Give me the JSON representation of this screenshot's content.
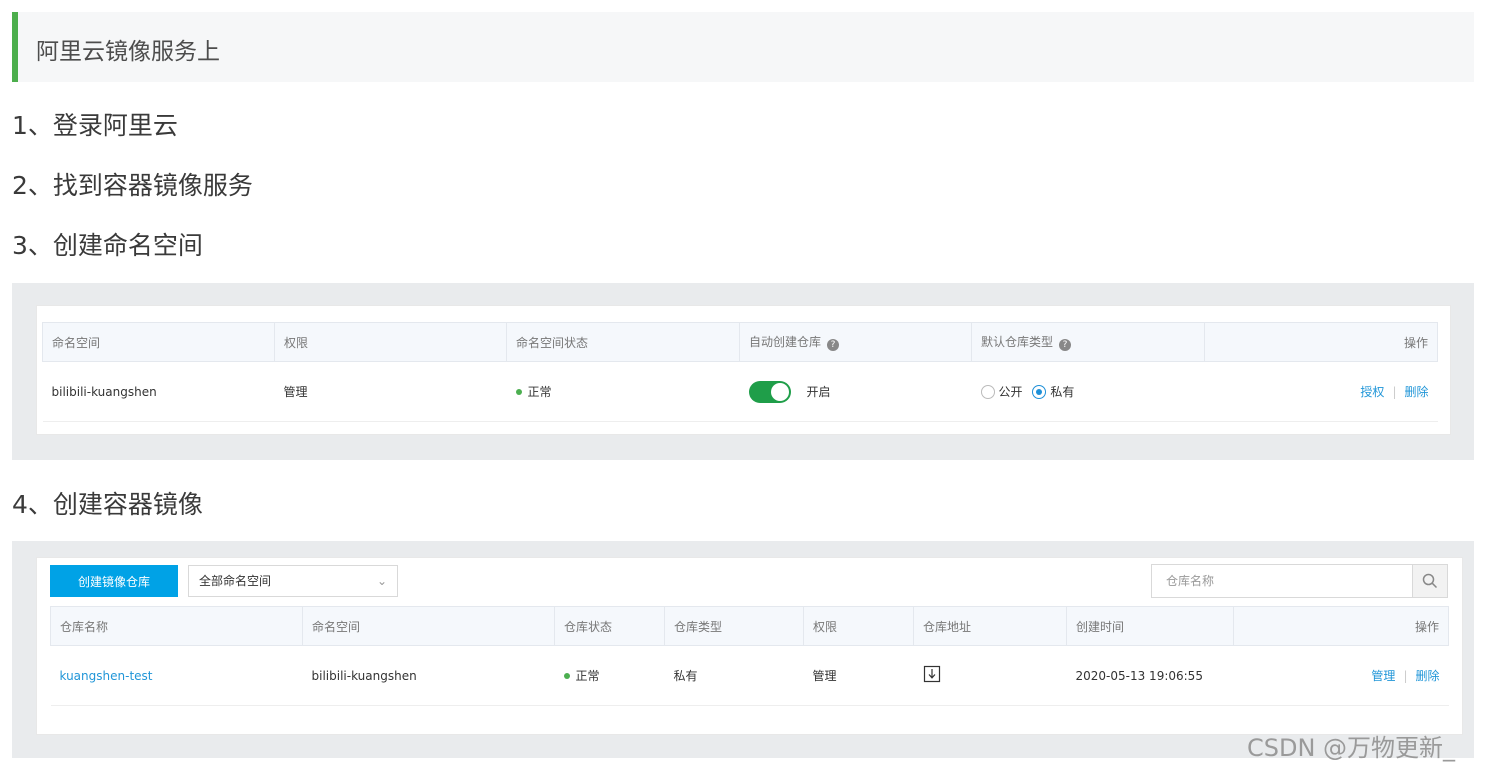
{
  "heading": "阿里云镜像服务上",
  "steps": [
    "1、登录阿里云",
    "2、找到容器镜像服务",
    "3、创建命名空间",
    "4、创建容器镜像"
  ],
  "namespace_table": {
    "headers": [
      "命名空间",
      "权限",
      "命名空间状态",
      "自动创建仓库",
      "默认仓库类型",
      "操作"
    ],
    "help_icon": "?",
    "row": {
      "namespace": "bilibili-kuangshen",
      "permission": "管理",
      "status": "正常",
      "auto_create_label": "开启",
      "auto_create_enabled": true,
      "repo_type_options": [
        "公开",
        "私有"
      ],
      "repo_type_selected": "私有",
      "actions": [
        "授权",
        "删除"
      ]
    }
  },
  "repo_section": {
    "create_button": "创建镜像仓库",
    "namespace_select": "全部命名空间",
    "search_placeholder": "仓库名称",
    "headers": [
      "仓库名称",
      "命名空间",
      "仓库状态",
      "仓库类型",
      "权限",
      "仓库地址",
      "创建时间",
      "操作"
    ],
    "row": {
      "repo_name": "kuangshen-test",
      "namespace": "bilibili-kuangshen",
      "status": "正常",
      "type": "私有",
      "permission": "管理",
      "created": "2020-05-13 19:06:55",
      "actions": [
        "管理",
        "删除"
      ]
    }
  },
  "colors": {
    "accent": "#4cae4c",
    "primary": "#00a2e6",
    "link": "#2196d8",
    "toggle": "#1f9e49",
    "status_ok": "#4caf50"
  },
  "watermark": "CSDN @万物更新_"
}
